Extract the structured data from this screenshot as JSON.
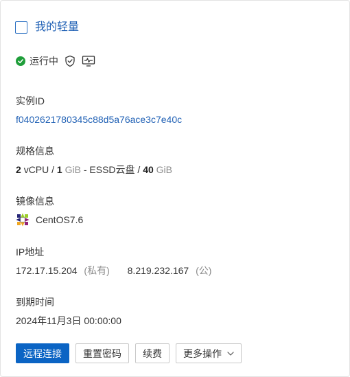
{
  "title": "我的轻量",
  "status": {
    "text": "运行中",
    "color": "#1f9e3a",
    "icons": [
      "check-circle-icon",
      "shield-check-icon",
      "monitor-icon"
    ]
  },
  "instance": {
    "label": "实例ID",
    "id": "f0402621780345c88d5a76ace3c7e40c"
  },
  "spec": {
    "label": "规格信息",
    "vcpu_count": "2",
    "vcpu_unit": "vCPU",
    "sep1": "/",
    "mem_value": "1",
    "mem_unit": "GiB",
    "dash": "-",
    "disk_type": "ESSD云盘",
    "sep2": "/",
    "disk_size": "40",
    "disk_unit": "GiB"
  },
  "image": {
    "label": "镜像信息",
    "os": "CentOS7.6",
    "icon": "centos-logo-icon"
  },
  "ip": {
    "label": "IP地址",
    "private_ip": "172.17.15.204",
    "private_tag": "(私有)",
    "public_ip": "8.219.232.167",
    "public_tag": "(公)"
  },
  "expiry": {
    "label": "到期时间",
    "date": "2024年11月3日 00:00:00"
  },
  "buttons": {
    "remote": "远程连接",
    "reset_password": "重置密码",
    "renew": "续费",
    "more": "更多操作"
  },
  "colors": {
    "accent": "#1e5fb4",
    "primary_button": "#0b64c4"
  }
}
